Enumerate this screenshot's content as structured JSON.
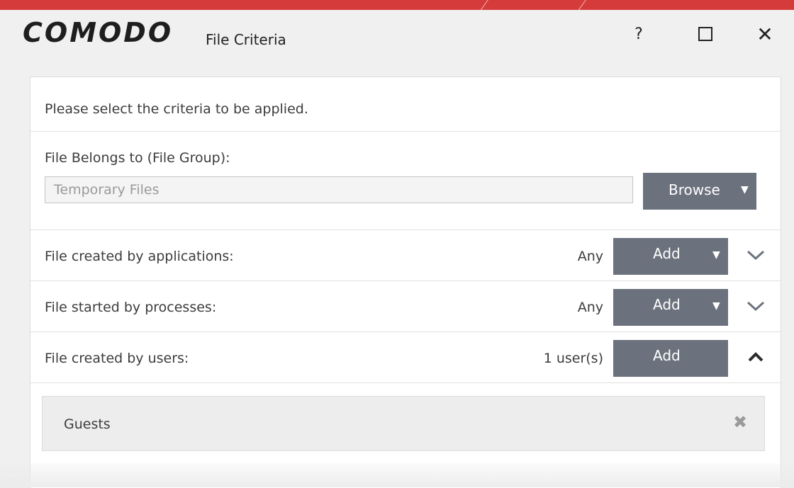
{
  "window": {
    "logo": "COMODO",
    "title": "File Criteria",
    "help_label": "?",
    "close_label": "✕"
  },
  "colors": {
    "top_accent": "#d63b3b",
    "button_bg": "#6c727d",
    "panel_bg": "#ffffff"
  },
  "panel": {
    "intro_text": "Please select the criteria to be applied.",
    "file_group": {
      "label": "File Belongs to (File Group):",
      "value": "Temporary Files",
      "browse_label": "Browse",
      "browse_caret": "▼"
    },
    "criteria": [
      {
        "label": "File created by applications:",
        "value": "Any",
        "button_label": "Add",
        "caret": "▼",
        "expand_icon": "chevron-down-icon"
      },
      {
        "label": "File started by processes:",
        "value": "Any",
        "button_label": "Add",
        "caret": "▼",
        "expand_icon": "chevron-down-icon"
      },
      {
        "label": "File created by users:",
        "value": "1 user(s)",
        "button_label": "Add",
        "expand_icon": "chevron-up-icon"
      }
    ],
    "users": [
      {
        "name": "Guests",
        "remove_label": "✖"
      }
    ]
  }
}
